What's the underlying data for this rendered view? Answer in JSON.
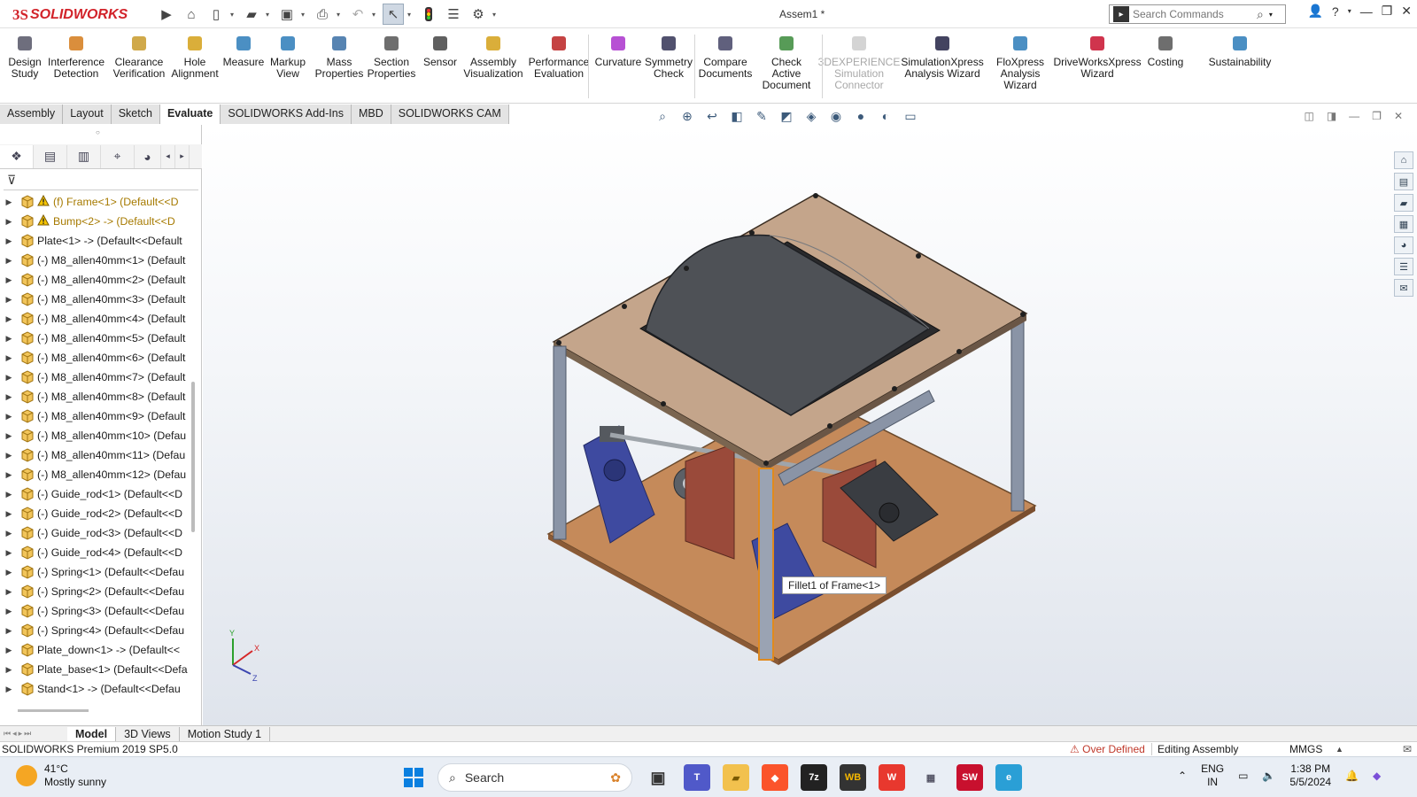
{
  "app": {
    "logo_prefix": "3S",
    "logo_name": "SOLIDWORKS",
    "document_title": "Assem1 *"
  },
  "search": {
    "placeholder": "Search Commands"
  },
  "ribbon": {
    "buttons": [
      {
        "label": "Design Study",
        "icon": "design-study-icon"
      },
      {
        "label": "Interference Detection",
        "icon": "interference-icon"
      },
      {
        "label": "Clearance Verification",
        "icon": "clearance-icon"
      },
      {
        "label": "Hole Alignment",
        "icon": "hole-alignment-icon"
      },
      {
        "label": "Measure",
        "icon": "measure-icon"
      },
      {
        "label": "Markup View",
        "icon": "markup-icon"
      },
      {
        "label": "Mass Properties",
        "icon": "mass-properties-icon"
      },
      {
        "label": "Section Properties",
        "icon": "section-properties-icon"
      },
      {
        "label": "Sensor",
        "icon": "sensor-icon"
      },
      {
        "label": "Assembly Visualization",
        "icon": "assembly-visualization-icon"
      },
      {
        "label": "Performance Evaluation",
        "icon": "performance-icon"
      },
      {
        "label": "Curvature",
        "icon": "curvature-icon"
      },
      {
        "label": "Symmetry Check",
        "icon": "symmetry-icon"
      },
      {
        "label": "Compare Documents",
        "icon": "compare-icon"
      },
      {
        "label": "Check Active Document",
        "icon": "check-active-icon"
      },
      {
        "label": "3DEXPERIENCE Simulation Connector",
        "icon": "3dx-icon",
        "disabled": true
      },
      {
        "label": "SimulationXpress Analysis Wizard",
        "icon": "simxpress-icon"
      },
      {
        "label": "FloXpress Analysis Wizard",
        "icon": "floxpress-icon"
      },
      {
        "label": "DriveWorksXpress Wizard",
        "icon": "driveworks-icon"
      },
      {
        "label": "Costing",
        "icon": "costing-icon"
      },
      {
        "label": "Sustainability",
        "icon": "sustainability-icon"
      }
    ]
  },
  "command_tabs": [
    "Assembly",
    "Layout",
    "Sketch",
    "Evaluate",
    "SOLIDWORKS Add-Ins",
    "MBD",
    "SOLIDWORKS CAM"
  ],
  "active_command_tab": "Evaluate",
  "tree": [
    {
      "label": "(f) Frame<1> (Default<<D",
      "warning": true
    },
    {
      "label": "Bump<2> -> (Default<<D",
      "warning": true
    },
    {
      "label": "Plate<1> -> (Default<<Default"
    },
    {
      "label": "(-) M8_allen40mm<1> (Default"
    },
    {
      "label": "(-) M8_allen40mm<2> (Default"
    },
    {
      "label": "(-) M8_allen40mm<3> (Default"
    },
    {
      "label": "(-) M8_allen40mm<4> (Default"
    },
    {
      "label": "(-) M8_allen40mm<5> (Default"
    },
    {
      "label": "(-) M8_allen40mm<6> (Default"
    },
    {
      "label": "(-) M8_allen40mm<7> (Default"
    },
    {
      "label": "(-) M8_allen40mm<8> (Default"
    },
    {
      "label": "(-) M8_allen40mm<9> (Default"
    },
    {
      "label": "(-) M8_allen40mm<10> (Defau"
    },
    {
      "label": "(-) M8_allen40mm<11> (Defau"
    },
    {
      "label": "(-) M8_allen40mm<12> (Defau"
    },
    {
      "label": "(-) Guide_rod<1> (Default<<D"
    },
    {
      "label": "(-) Guide_rod<2> (Default<<D"
    },
    {
      "label": "(-) Guide_rod<3> (Default<<D"
    },
    {
      "label": "(-) Guide_rod<4> (Default<<D"
    },
    {
      "label": "(-) Spring<1> (Default<<Defau"
    },
    {
      "label": "(-) Spring<2> (Default<<Defau"
    },
    {
      "label": "(-) Spring<3> (Default<<Defau"
    },
    {
      "label": "(-) Spring<4> (Default<<Defau"
    },
    {
      "label": "Plate_down<1> -> (Default<<"
    },
    {
      "label": "Plate_base<1> (Default<<Defa"
    },
    {
      "label": "Stand<1> -> (Default<<Defau"
    }
  ],
  "viewport": {
    "tooltip": "Fillet1 of Frame<1>"
  },
  "bottom_tabs": [
    "Model",
    "3D Views",
    "Motion Study 1"
  ],
  "active_bottom_tab": "Model",
  "status": {
    "product": "SOLIDWORKS Premium 2019 SP5.0",
    "over_defined": "Over Defined",
    "editing": "Editing Assembly",
    "units": "MMGS"
  },
  "taskbar": {
    "temperature": "41°C",
    "weather": "Mostly sunny",
    "search": "Search",
    "lang_top": "ENG",
    "lang_bottom": "IN",
    "time": "1:38 PM",
    "date": "5/5/2024"
  },
  "colors": {
    "brand": "#d2232a",
    "plate": "#c4a58b",
    "base": "#c58a5a",
    "frame": "#8a94a6",
    "drum": "#4e5156",
    "stand": "#3e4aa0"
  }
}
